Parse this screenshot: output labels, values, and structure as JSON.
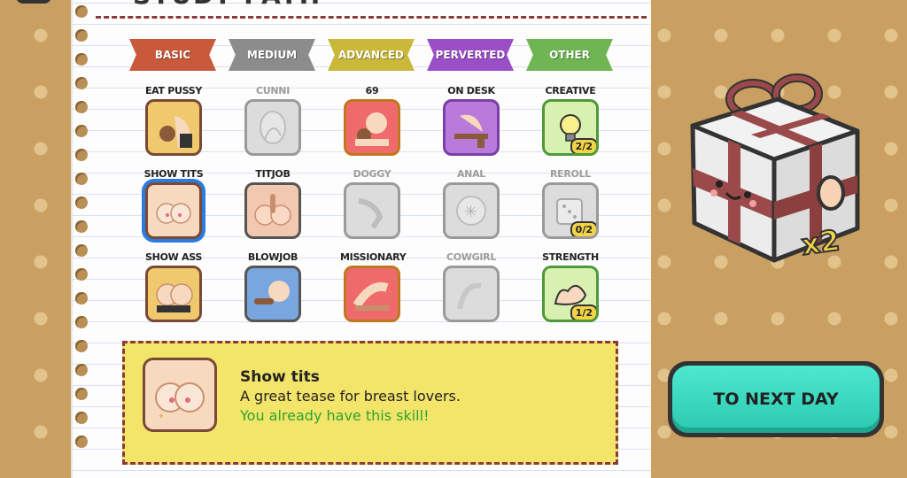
{
  "notebook": {
    "title_fragment": "STUDY PATH"
  },
  "tabs": [
    {
      "label": "BASIC",
      "color": "#c8593b"
    },
    {
      "label": "MEDIUM",
      "color": "#8c8c8c"
    },
    {
      "label": "ADVANCED",
      "color": "#c9b83a"
    },
    {
      "label": "PERVERTED",
      "color": "#9b4fc7"
    },
    {
      "label": "OTHER",
      "color": "#6fb553"
    }
  ],
  "skills": [
    {
      "label": "EAT PUSSY",
      "state": "owned",
      "border": "#7a4a34",
      "bg": "#f0c86e",
      "icon": "lick-icon"
    },
    {
      "label": "CUNNI",
      "state": "locked",
      "icon": "lips-icon"
    },
    {
      "label": "69",
      "state": "owned",
      "border": "#c07820",
      "bg": "#ef6a6a",
      "icon": "sixtynine-icon"
    },
    {
      "label": "ON DESK",
      "state": "owned",
      "border": "#7b3fa8",
      "bg": "#b97ad9",
      "icon": "desk-icon"
    },
    {
      "label": "CREATIVE",
      "state": "owned",
      "border": "#4e9a3a",
      "bg": "#d8f0b0",
      "icon": "lightbulb-icon",
      "badge": "2/2"
    },
    {
      "label": "SHOW TITS",
      "state": "owned",
      "selected": true,
      "border": "#7a4a34",
      "bg": "#f7d9c0",
      "icon": "tits-icon"
    },
    {
      "label": "TITJOB",
      "state": "owned",
      "border": "#555555",
      "bg": "#f2c8b0",
      "icon": "titjob-icon"
    },
    {
      "label": "DOGGY",
      "state": "locked",
      "icon": "doggy-icon"
    },
    {
      "label": "ANAL",
      "state": "locked",
      "icon": "snowflake-icon"
    },
    {
      "label": "REROLL",
      "state": "locked",
      "icon": "dice-icon",
      "badge": "0/2"
    },
    {
      "label": "SHOW ASS",
      "state": "owned",
      "border": "#7a4a34",
      "bg": "#f0c86e",
      "icon": "ass-icon"
    },
    {
      "label": "BLOWJOB",
      "state": "owned",
      "border": "#555555",
      "bg": "#7aa6e0",
      "icon": "blowjob-icon"
    },
    {
      "label": "MISSIONARY",
      "state": "owned",
      "border": "#c07820",
      "bg": "#ef6a6a",
      "icon": "missionary-icon"
    },
    {
      "label": "COWGIRL",
      "state": "locked",
      "icon": "cowgirl-icon"
    },
    {
      "label": "STRENGTH",
      "state": "owned",
      "border": "#4e9a3a",
      "bg": "#d8f0b0",
      "icon": "muscle-icon",
      "badge": "1/2"
    }
  ],
  "description": {
    "title": "Show tits",
    "text": "A great tease for breast lovers.",
    "status": "You already have this skill!",
    "status_color": "#2ea52e"
  },
  "reward": {
    "icon": "gift-box-icon",
    "multiplier": "x2"
  },
  "next_button": {
    "label": "TO NEXT DAY"
  }
}
